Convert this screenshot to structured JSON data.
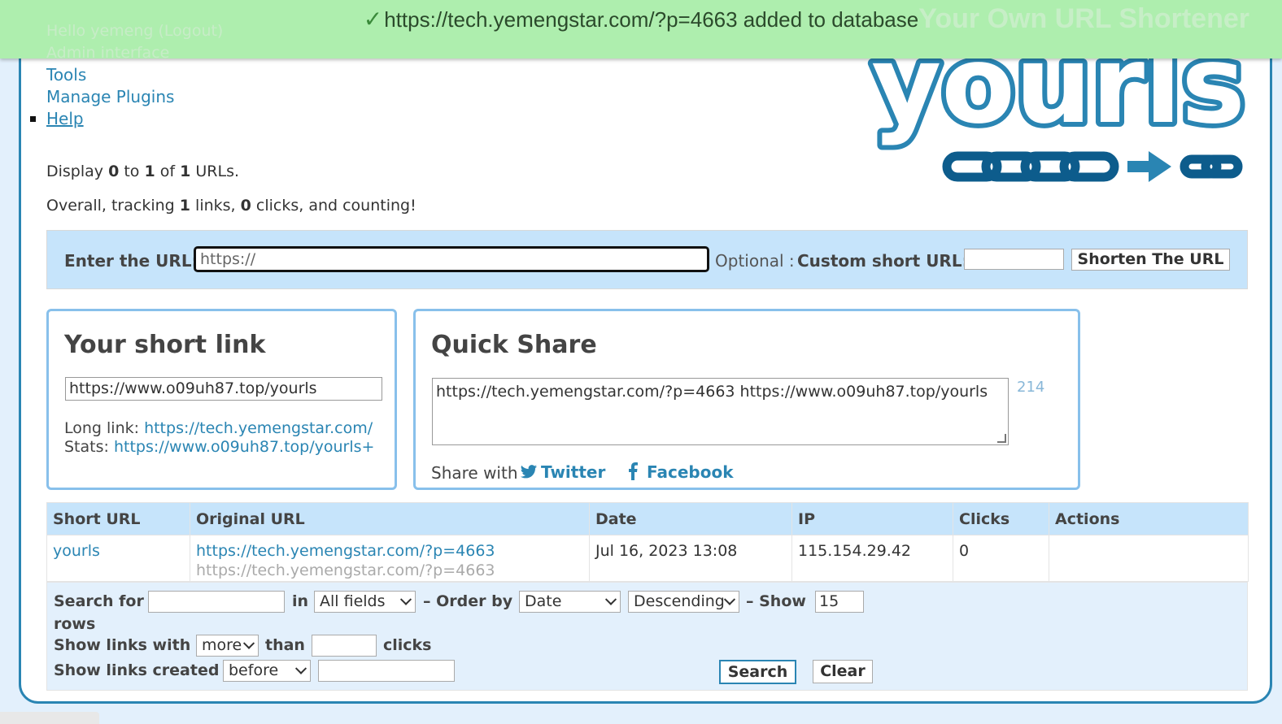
{
  "notice": {
    "message": "https://tech.yemengstar.com/?p=4663 added to database"
  },
  "header": {
    "title": "Your Own URL Shortener",
    "user": "Hello yemeng (Logout)",
    "admin_link": "Admin interface",
    "nav": {
      "tools": "Tools",
      "plugins": "Manage Plugins",
      "help": "Help"
    }
  },
  "logo_text": "yourls",
  "stats": {
    "display_prefix": "Display ",
    "display_from": "0",
    "display_to_word": " to ",
    "display_to": "1",
    "display_of_word": " of ",
    "display_total": "1",
    "display_suffix": " URLs.",
    "overall_prefix": "Overall, tracking ",
    "links": "1",
    "links_word": " links, ",
    "clicks": "0",
    "clicks_suffix": " clicks, and counting!"
  },
  "form": {
    "enter_url_label": "Enter the URL:",
    "url_value": "https://",
    "optional": "Optional :",
    "custom_label": "Custom short URL:",
    "shorten_button": "Shorten The URL"
  },
  "short_link_box": {
    "title": "Your short link",
    "short_url": "https://www.o09uh87.top/yourls",
    "long_label": "Long link: ",
    "long_url": "https://tech.yemengstar.com/",
    "stats_label": "Stats: ",
    "stats_url": "https://www.o09uh87.top/yourls+"
  },
  "quick_share": {
    "title": "Quick Share",
    "text": "https://tech.yemengstar.com/?p=4663 https://www.o09uh87.top/yourls",
    "count": "214",
    "share_with": "Share with",
    "twitter": "Twitter",
    "facebook": "Facebook"
  },
  "table": {
    "headers": [
      "Short URL",
      "Original URL",
      "Date",
      "IP",
      "Clicks",
      "Actions"
    ],
    "rows": [
      {
        "short": "yourls",
        "original": "https://tech.yemengstar.com/?p=4663",
        "original_sub": "https://tech.yemengstar.com/?p=4663",
        "date": "Jul 16, 2023 13:08",
        "ip": "115.154.29.42",
        "clicks": "0",
        "actions": ""
      }
    ]
  },
  "filters": {
    "search_for": "Search for",
    "in": "in",
    "field_select": "All fields",
    "order_by": "– Order by",
    "order_select": "Date",
    "direction_select": "Descending",
    "show": "– Show",
    "show_value": "15",
    "rows": "rows",
    "show_links_with": "Show links with",
    "more_select": "more",
    "than": "than",
    "clicks": "clicks",
    "show_links_created": "Show links created",
    "created_select": "before",
    "search_button": "Search",
    "clear_button": "Clear"
  },
  "colors": {
    "accent": "#2a85b3",
    "notice_bg": "#aeeeae",
    "light_blue": "#c6e4fb"
  }
}
